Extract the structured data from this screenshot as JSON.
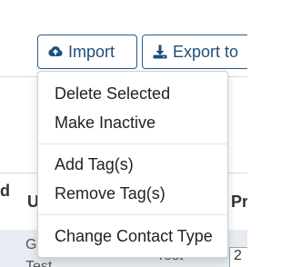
{
  "toolbar": {
    "import_label": "Import",
    "export_label": "Export to"
  },
  "table": {
    "columns": [
      {
        "label": "d"
      },
      {
        "label": "U"
      },
      {
        "label": "Pr"
      }
    ],
    "row": {
      "first_name_partial": "Gr",
      "second_line_partial": "Test",
      "mid_value": "Test",
      "input_value": "2"
    }
  },
  "menu": {
    "items": [
      {
        "label": "Delete Selected"
      },
      {
        "label": "Make Inactive"
      },
      {
        "label": "Add Tag(s)"
      },
      {
        "label": "Remove Tag(s)"
      },
      {
        "label": "Change Contact Type"
      }
    ]
  },
  "colors": {
    "accent": "#1f4e7a",
    "row_highlight": "#e6ecf1"
  },
  "icons": {
    "import": "cloud-upload-icon",
    "export": "download-icon"
  }
}
